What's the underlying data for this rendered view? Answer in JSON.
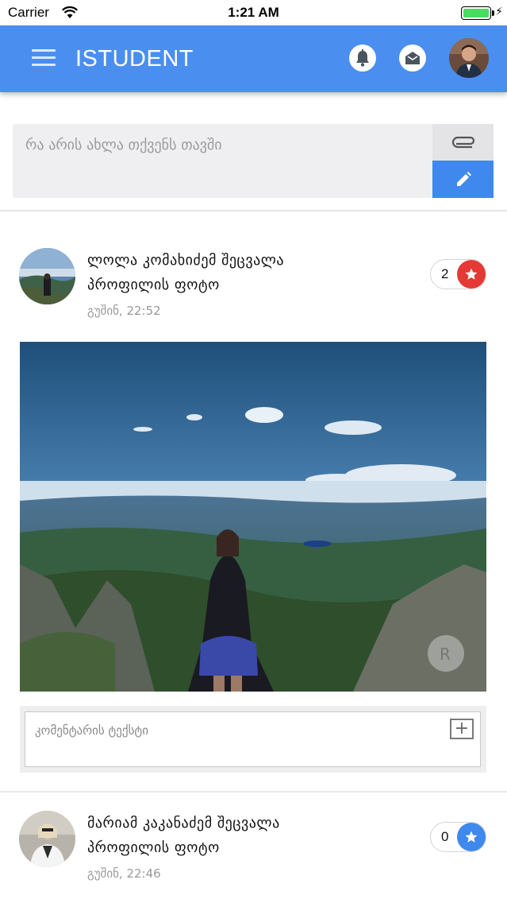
{
  "status_bar": {
    "carrier": "Carrier",
    "time": "1:21 AM"
  },
  "app_bar": {
    "title": "ISTUDENT"
  },
  "composer": {
    "placeholder": "რა არის ახლა თქვენს თავში"
  },
  "posts": [
    {
      "author_line1": "ლოლა კომახიძემ შეცვალა",
      "author_line2": "პროფილის ფოტო",
      "time": "გუშინ, 22:52",
      "likes": "2",
      "star_color": "#e53935",
      "comment_placeholder": "კომენტარის ტექსტი"
    },
    {
      "author_line1": "მარიამ კაკანაძემ შეცვალა",
      "author_line2": "პროფილის ფოტო",
      "time": "გუშინ, 22:46",
      "likes": "0",
      "star_color": "#3f88ee"
    }
  ],
  "colors": {
    "primary": "#4a8ff0",
    "accent_blue": "#3f88ee",
    "like_red": "#e53935"
  },
  "icons": {
    "menu": "hamburger-icon",
    "bell": "bell-icon",
    "mail": "envelope-open-icon",
    "attach": "paperclip-icon",
    "post": "pencil-icon",
    "star": "star-icon",
    "add": "plus-box-icon"
  }
}
